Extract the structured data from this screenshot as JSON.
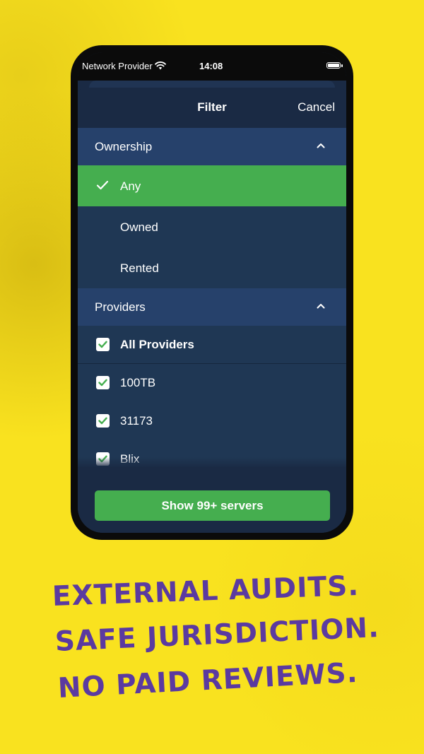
{
  "status_bar": {
    "carrier": "Network Provider",
    "time": "14:08"
  },
  "nav": {
    "title": "Filter",
    "cancel_label": "Cancel"
  },
  "ownership": {
    "title": "Ownership",
    "options": [
      {
        "label": "Any",
        "selected": true
      },
      {
        "label": "Owned",
        "selected": false
      },
      {
        "label": "Rented",
        "selected": false
      }
    ]
  },
  "providers": {
    "title": "Providers",
    "items": [
      {
        "label": "All Providers",
        "checked": true
      },
      {
        "label": "100TB",
        "checked": true
      },
      {
        "label": "31173",
        "checked": true
      },
      {
        "label": "Blix",
        "checked": true
      }
    ]
  },
  "footer": {
    "button_label": "Show 99+ servers"
  },
  "tagline": {
    "line1": "External audits.",
    "line2": "Safe jurisdiction.",
    "line3": "No paid reviews."
  },
  "colors": {
    "background": "#f9e21f",
    "accent_green": "#45ae4f",
    "sheet": "#1a2a44",
    "section_header": "#26416b",
    "tagline": "#5b3aa0"
  }
}
